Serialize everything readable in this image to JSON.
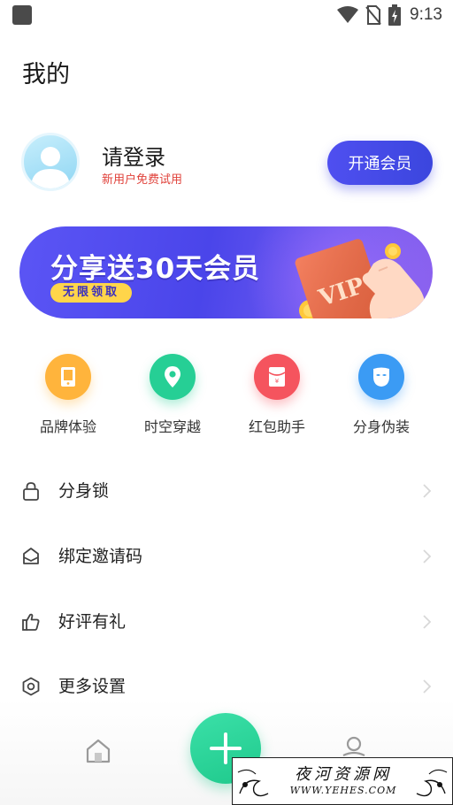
{
  "status_bar": {
    "time": "9:13"
  },
  "title": "我的",
  "profile": {
    "login_label": "请登录",
    "trial_text": "新用户免费试用",
    "vip_button": "开通会员"
  },
  "banner": {
    "title": "分享送30天会员",
    "badge": "无限领取",
    "card_text": "VIP"
  },
  "features": [
    {
      "label": "品牌体验",
      "icon": "tablet-icon",
      "color": "#ffb43c"
    },
    {
      "label": "时空穿越",
      "icon": "location-pin-icon",
      "color": "#26cf95"
    },
    {
      "label": "红包助手",
      "icon": "red-envelope-icon",
      "color": "#f5545e"
    },
    {
      "label": "分身伪装",
      "icon": "mask-icon",
      "color": "#3b9bf4"
    }
  ],
  "menu": [
    {
      "label": "分身锁",
      "icon": "lock-icon"
    },
    {
      "label": "绑定邀请码",
      "icon": "envelope-icon"
    },
    {
      "label": "好评有礼",
      "icon": "thumbs-up-icon"
    },
    {
      "label": "更多设置",
      "icon": "settings-icon"
    }
  ],
  "colors": {
    "accent": "#4a4aec",
    "green": "#22cc8f",
    "trial_red": "#e0413a"
  },
  "watermark": {
    "text": "夜河资源网",
    "url": "WWW.YEHES.COM"
  }
}
